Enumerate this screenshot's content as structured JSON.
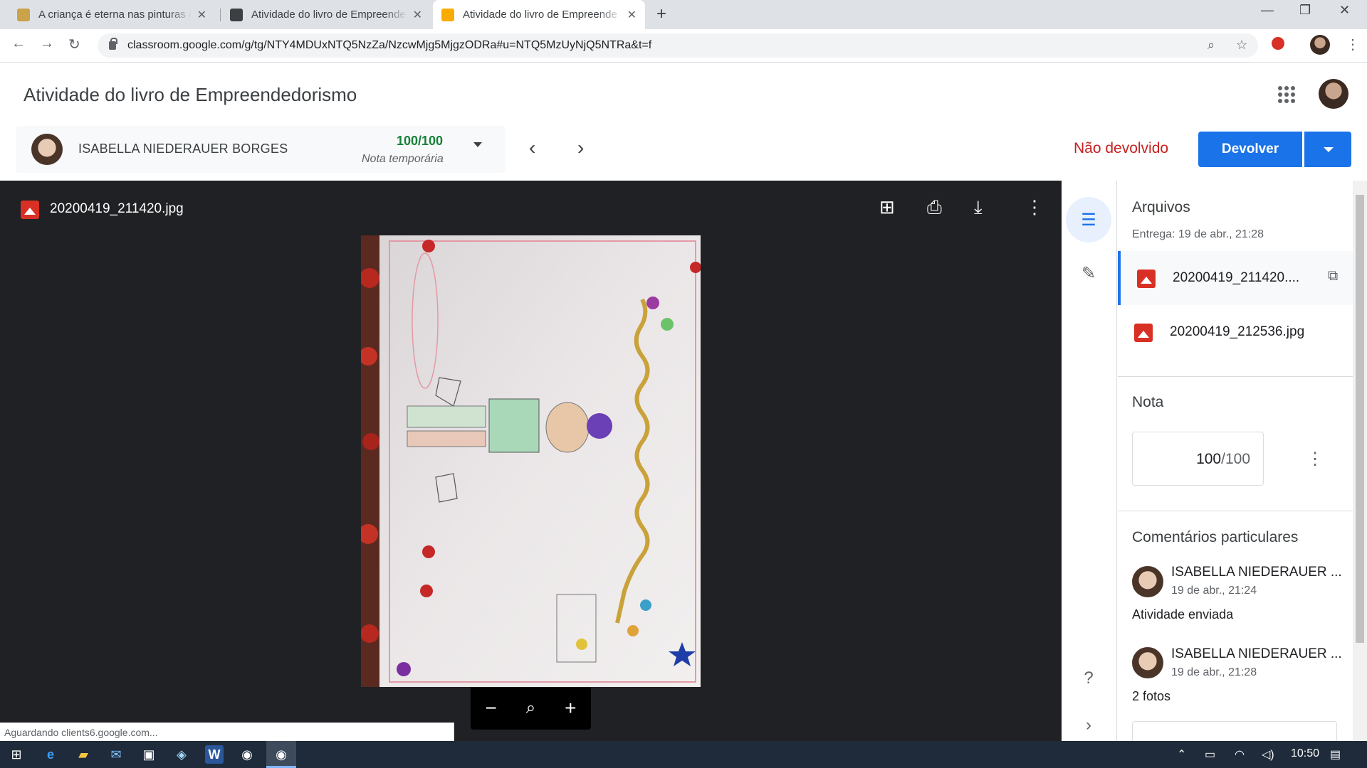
{
  "browser": {
    "tabs": [
      {
        "title": "A criança é eterna nas pinturas de",
        "active": false
      },
      {
        "title": "Atividade do livro de Empreende",
        "active": false
      },
      {
        "title": "Atividade do livro de Empreende",
        "active": true
      }
    ],
    "url": "classroom.google.com/g/tg/NTY4MDUxNTQ5NzZa/NzcwMjg5MjgzODRa#u=NTQ5MzUyNjQ5NTRa&t=f"
  },
  "header": {
    "title": "Atividade do livro de Empreendedorismo"
  },
  "student": {
    "name": "ISABELLA NIEDERAUER BORGES",
    "grade": "100/100",
    "grade_note": "Nota temporária"
  },
  "actions": {
    "status": "Não devolvido",
    "return_label": "Devolver"
  },
  "viewer": {
    "file_name": "20200419_211420.jpg"
  },
  "side": {
    "files_title": "Arquivos",
    "delivery": "Entrega: 19 de abr., 21:28",
    "files": [
      {
        "name": "20200419_211420...."
      },
      {
        "name": "20200419_212536.jpg"
      }
    ],
    "grade_title": "Nota",
    "grade_value": "100",
    "grade_total": "/100",
    "comments_title": "Comentários particulares",
    "comments": [
      {
        "author": "ISABELLA NIEDERAUER ...",
        "date": "19 de abr., 21:24",
        "text": "Atividade enviada"
      },
      {
        "author": "ISABELLA NIEDERAUER ...",
        "date": "19 de abr., 21:28",
        "text": "2 fotos"
      }
    ]
  },
  "status_bar": {
    "text": "Aguardando clients6.google.com..."
  },
  "taskbar": {
    "time": "10:50"
  },
  "colors": {
    "accent": "#1a73e8",
    "grade_green": "#188038",
    "not_returned_red": "#c5221f",
    "viewer_bg": "#202124"
  }
}
